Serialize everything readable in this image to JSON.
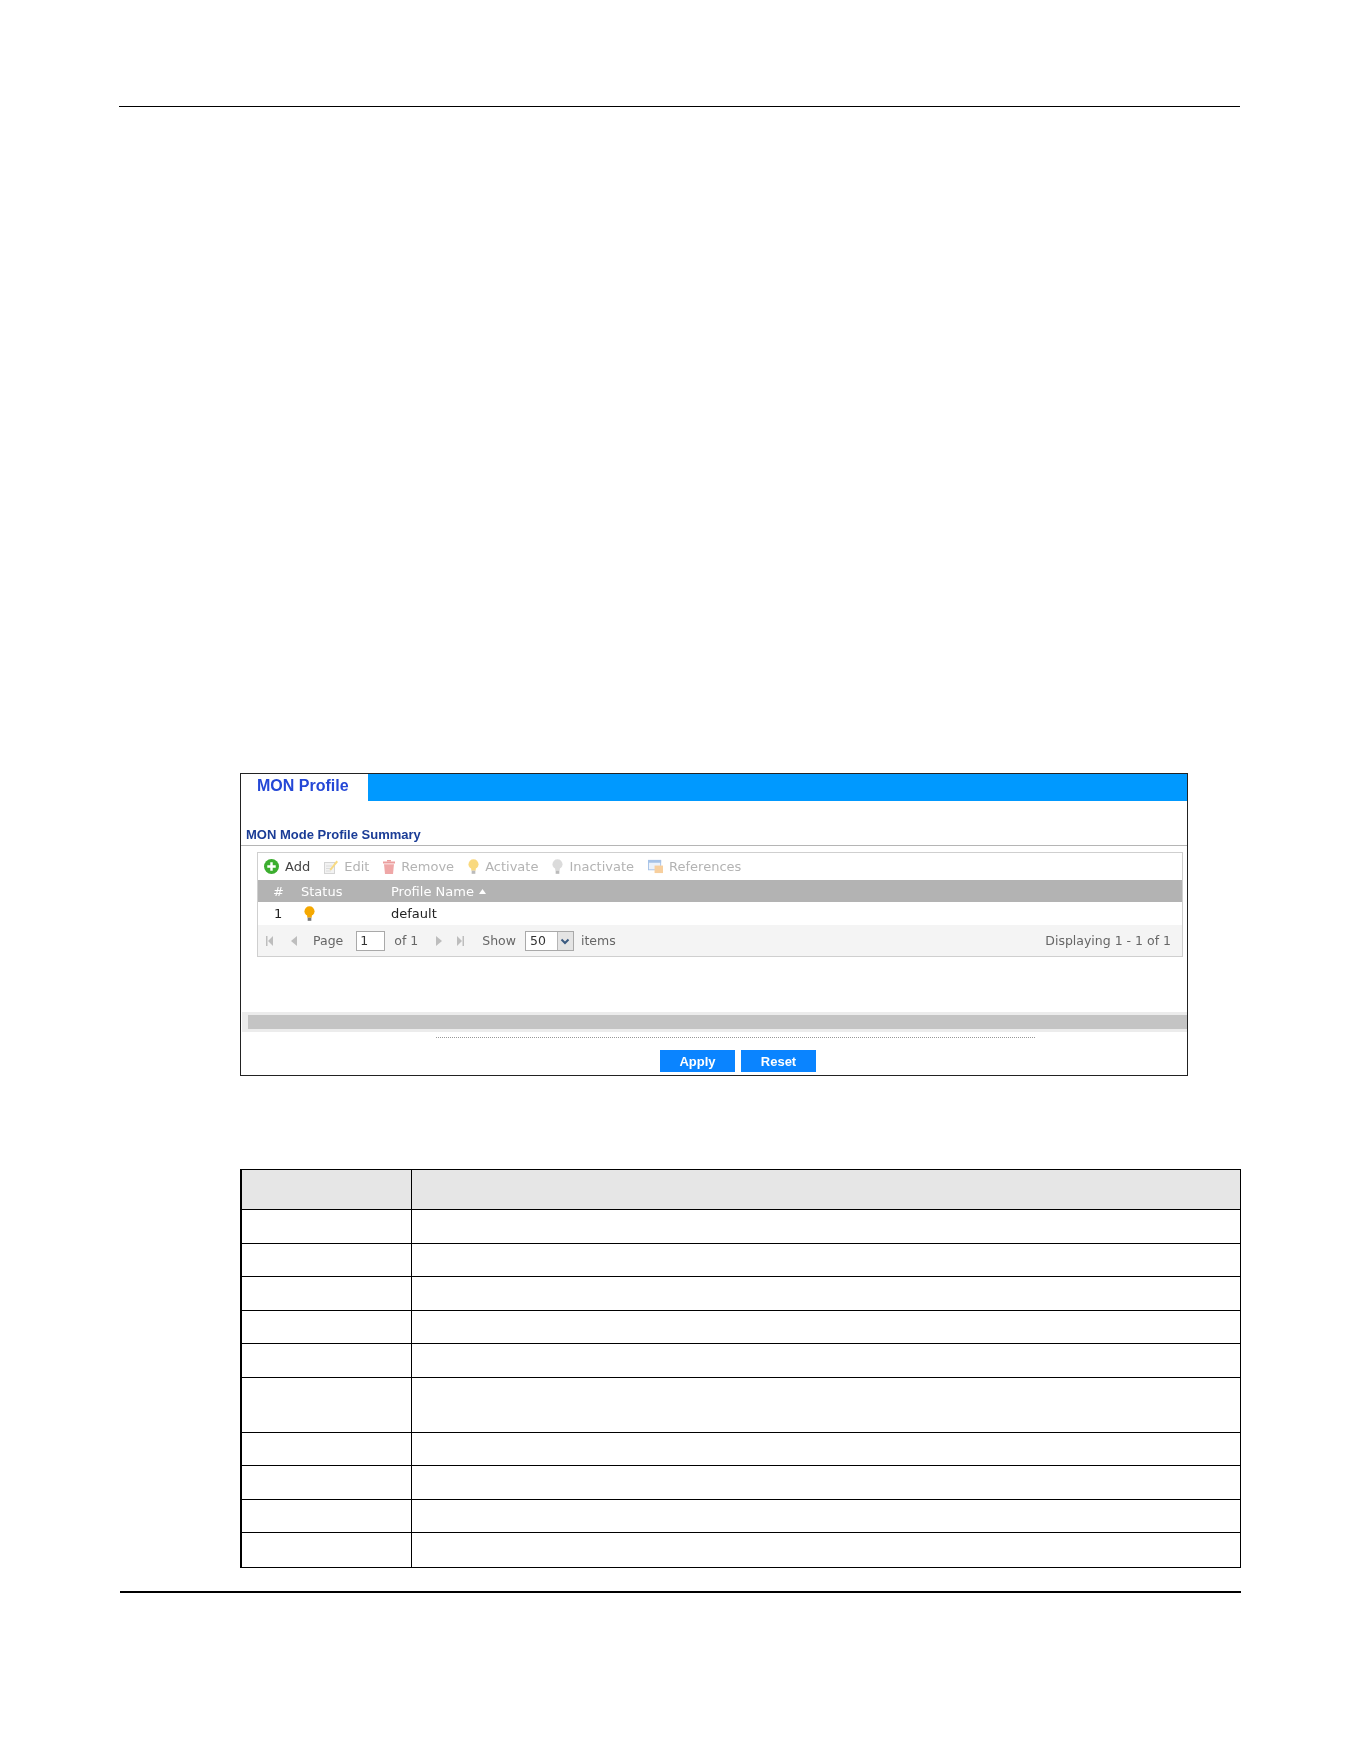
{
  "tabs": [
    {
      "label": "MON Profile",
      "selected": true
    }
  ],
  "section_title": "MON Mode Profile Summary",
  "toolbar": [
    {
      "kind": "add",
      "label": "Add",
      "disabled": false
    },
    {
      "kind": "edit",
      "label": "Edit",
      "disabled": true
    },
    {
      "kind": "remove",
      "label": "Remove",
      "disabled": true
    },
    {
      "kind": "activate",
      "label": "Activate",
      "disabled": true
    },
    {
      "kind": "inactivate",
      "label": "Inactivate",
      "disabled": true
    },
    {
      "kind": "references",
      "label": "References",
      "disabled": true
    }
  ],
  "table": {
    "columns": [
      {
        "label": "#",
        "sorted": false
      },
      {
        "label": "Status",
        "sorted": false
      },
      {
        "label": "Profile Name",
        "sorted": true
      }
    ],
    "rows": [
      {
        "number": "1",
        "active": true,
        "profile_name": "default"
      }
    ]
  },
  "pagination": {
    "page_label": "Page",
    "page": "1",
    "of_label": "of 1",
    "show_label": "Show",
    "page_size": "50",
    "items_label": "items",
    "summary": "Displaying 1 - 1 of 1"
  },
  "buttons": [
    {
      "label": "Apply"
    },
    {
      "label": "Reset"
    }
  ],
  "description_table": {
    "rows": [
      {
        "kind": "header"
      },
      {
        "kind": "single"
      },
      {
        "kind": "single"
      },
      {
        "kind": "single"
      },
      {
        "kind": "single"
      },
      {
        "kind": "single"
      },
      {
        "kind": "double"
      },
      {
        "kind": "single"
      },
      {
        "kind": "single"
      },
      {
        "kind": "single"
      },
      {
        "kind": "single"
      }
    ]
  }
}
